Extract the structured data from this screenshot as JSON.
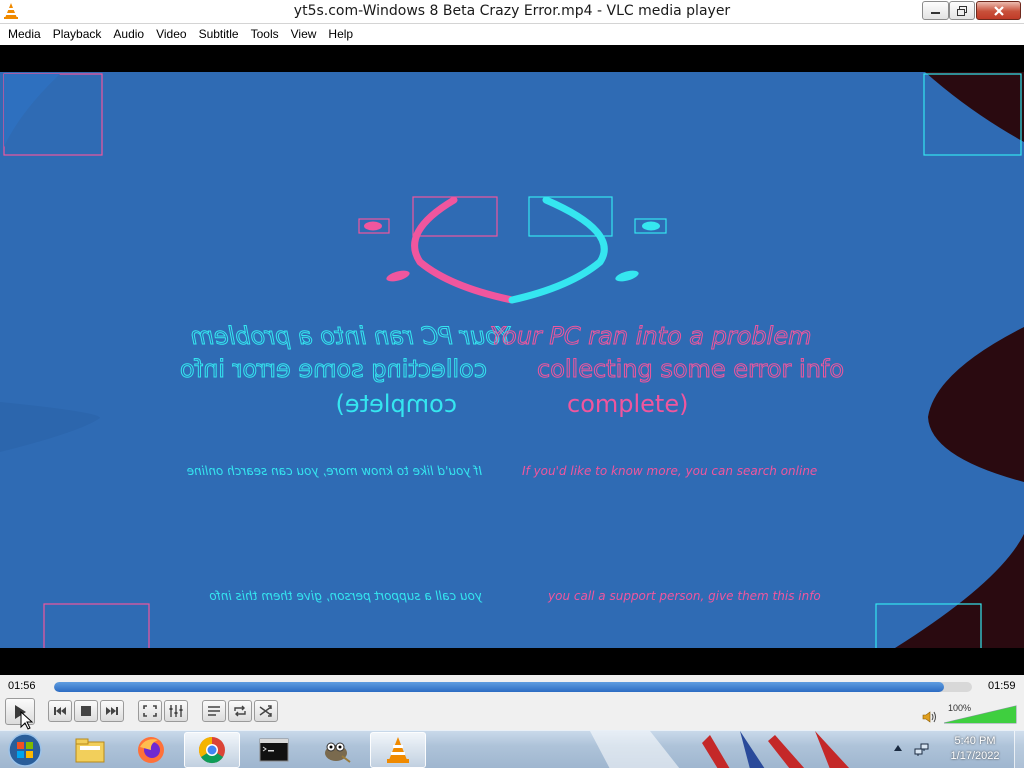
{
  "window": {
    "title": "yt5s.com-Windows 8 Beta Crazy Error.mp4 - VLC media player"
  },
  "menu": {
    "items": [
      "Media",
      "Playback",
      "Audio",
      "Video",
      "Subtitle",
      "Tools",
      "View",
      "Help"
    ]
  },
  "video": {
    "line1_left": "Your PC ran into a problem",
    "line1_right": "Your PC ran into a problem",
    "line2_left": "collecting some error info",
    "line2_right": "collecting some error info",
    "line3_left": "complete)",
    "line3_right": "complete)",
    "line4_left": "If you'd like to know more, you can search online",
    "line4_right": "If you'd like to know more, you can search online",
    "line5_left": "you call a support person, give them this info",
    "line5_right": "you call a support person, give them this info",
    "colors": {
      "background": "#2f6bb4",
      "pink": "#f0569e",
      "cyan": "#35e6f0",
      "dark": "#2a0a10"
    }
  },
  "playback": {
    "elapsed": "01:56",
    "total": "01:59",
    "progress": 0.97,
    "volume_label": "100%",
    "volume": 1.0
  },
  "controls": {
    "buttons": [
      "play-icon",
      "previous-icon",
      "stop-icon",
      "next-icon",
      "fullscreen-icon",
      "extended-settings-icon",
      "playlist-icon",
      "loop-icon",
      "shuffle-icon",
      "speaker-icon"
    ]
  },
  "taskbar": {
    "apps": [
      "start-orb-icon",
      "file-explorer-icon",
      "firefox-icon",
      "chrome-icon",
      "command-prompt-icon",
      "gimp-icon",
      "vlc-icon"
    ],
    "time": "5:40 PM",
    "date": "1/17/2022"
  }
}
